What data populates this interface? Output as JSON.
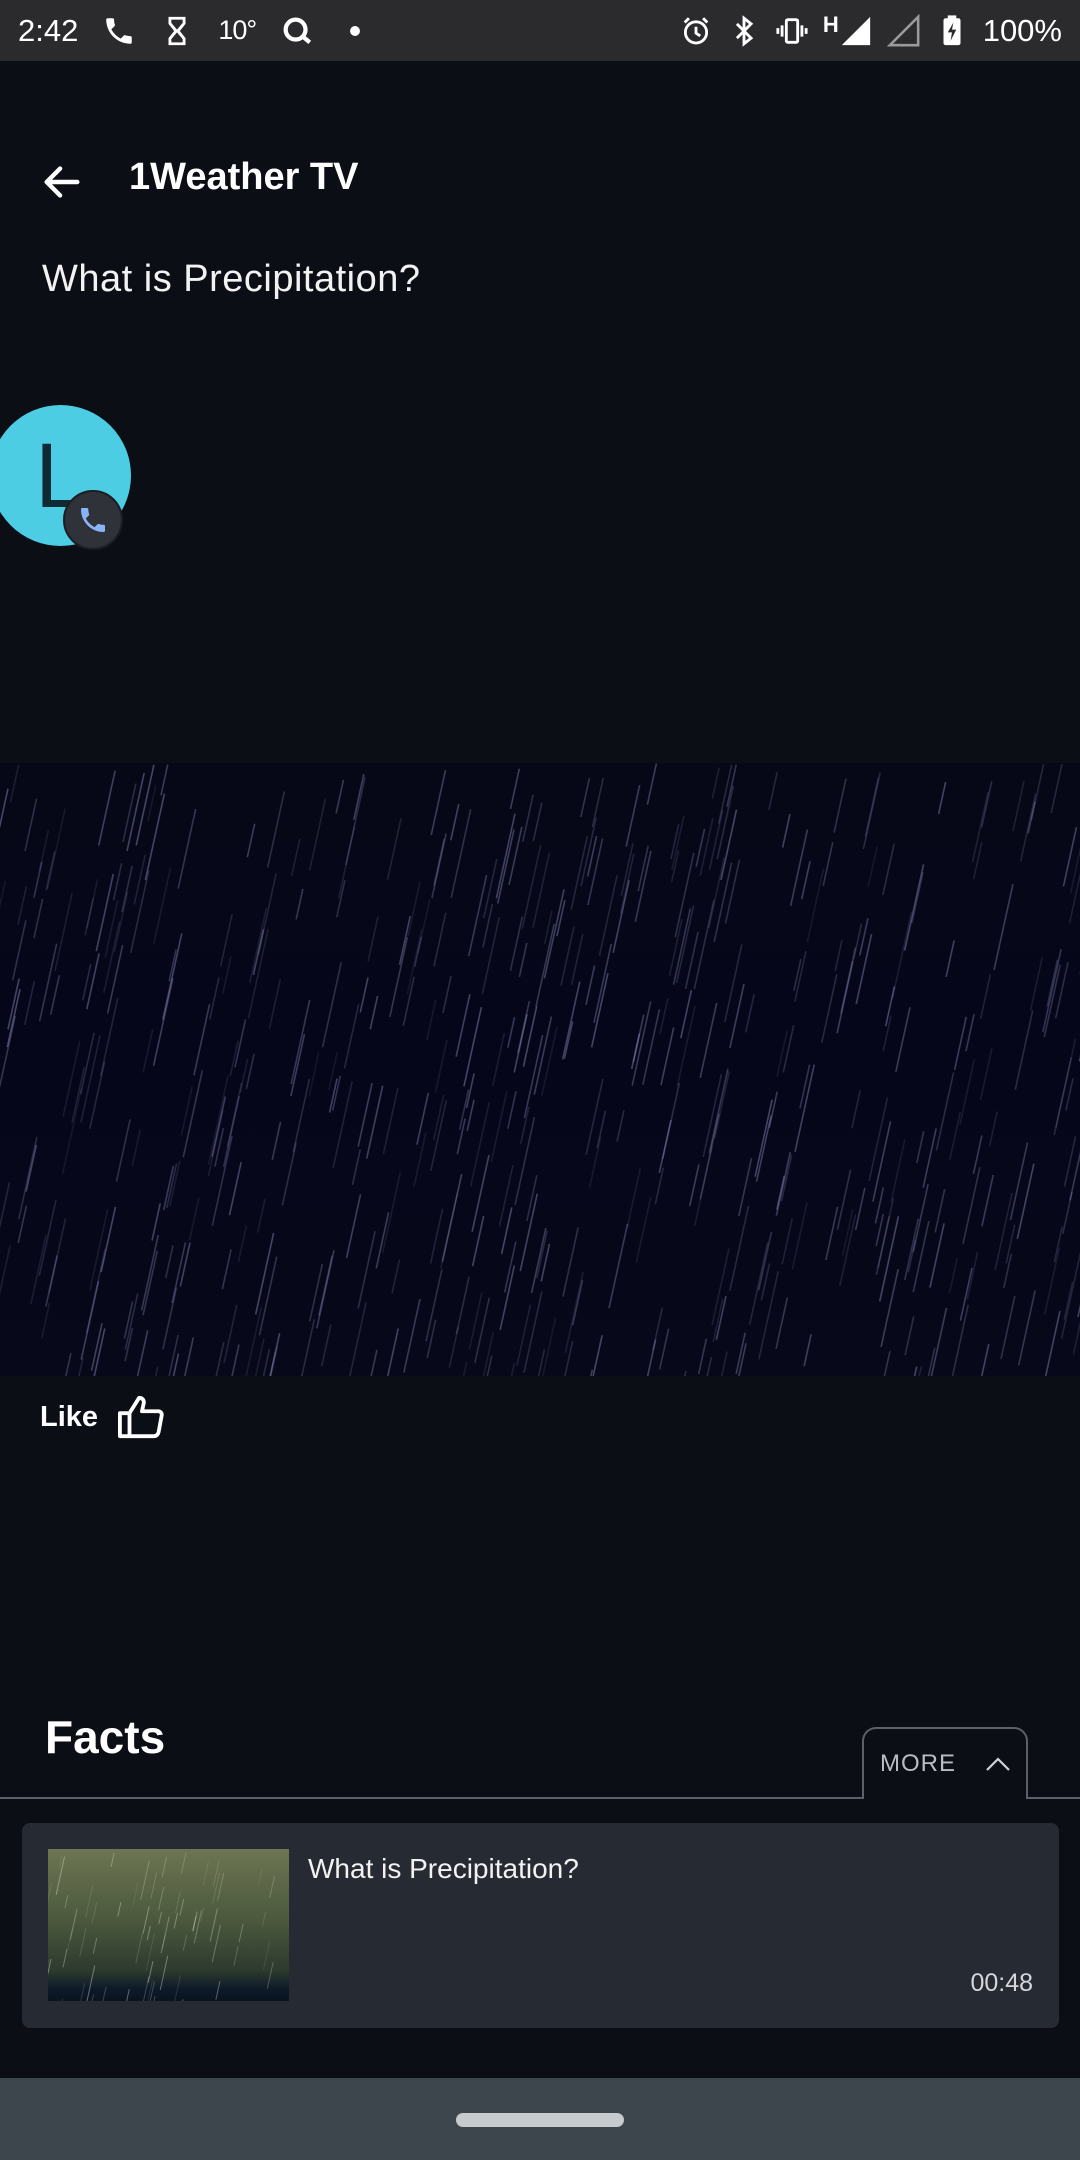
{
  "status_bar": {
    "time": "2:42",
    "temperature": "10°",
    "battery": "100%",
    "network": "H",
    "icons": [
      "phone-icon",
      "hourglass-icon",
      "search-q-icon",
      "dot-icon",
      "alarm-icon",
      "bluetooth-icon",
      "vibrate-icon",
      "signal-icon",
      "signal-empty-icon",
      "battery-charging-icon"
    ]
  },
  "header": {
    "back_icon": "arrow-left-icon",
    "title": "1Weather TV"
  },
  "video": {
    "title": "What is Precipitation?"
  },
  "caller_bubble": {
    "letter": "L",
    "color": "#4dcde4",
    "badge_icon": "phone-icon"
  },
  "like": {
    "label": "Like",
    "icon": "thumbs-up-icon"
  },
  "facts": {
    "title": "Facts",
    "more_label": "MORE",
    "more_icon": "chevron-up-icon",
    "items": [
      {
        "title": "What is Precipitation?",
        "duration": "00:48"
      }
    ]
  },
  "colors": {
    "background": "#0b0e15",
    "card": "#262a33",
    "status_bar": "#2b2b2d",
    "nav_bar": "#3e464d"
  }
}
